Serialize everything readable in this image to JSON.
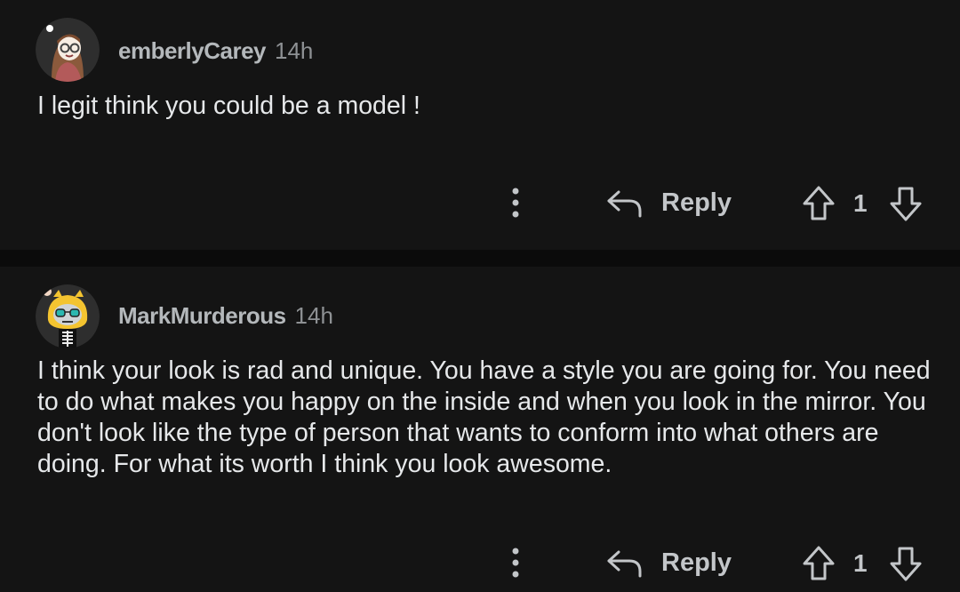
{
  "comments": [
    {
      "username": "emberlyCarey",
      "time": "14h",
      "text": "I legit think you could be a model !",
      "reply_label": "Reply",
      "score": "1",
      "avatar_icon": "girl-with-glasses-avatar-icon"
    },
    {
      "username": "MarkMurderous",
      "time": "14h",
      "text": "I think your look is rad and unique. You have a style you are going for. You need to do what makes you happy on the inside and when you look in the mirror. You don't look like the type of person that wants to conform into what others are doing. For what its worth I think you look awesome.",
      "reply_label": "Reply",
      "score": "1",
      "avatar_icon": "skeleton-in-yellow-hood-avatar-icon"
    }
  ],
  "colors": {
    "background": "#0b0b0b",
    "card": "#141414",
    "text": "#e6e8ea",
    "meta": "#8e9194"
  }
}
